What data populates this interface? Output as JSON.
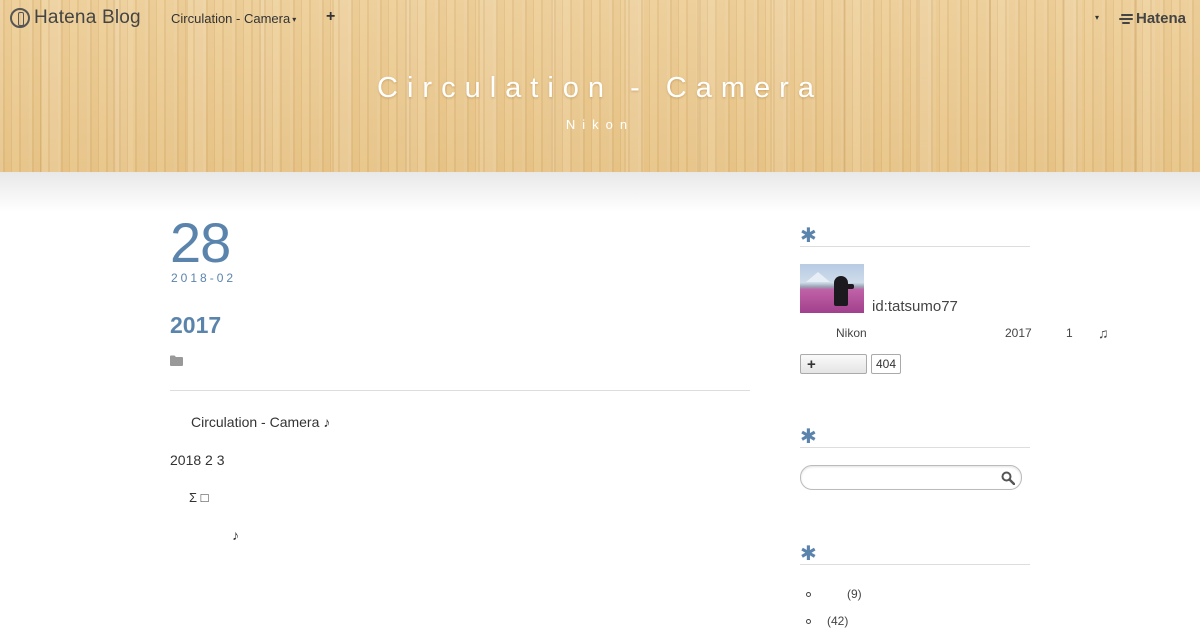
{
  "navbar": {
    "logo_text": "Hatena Blog",
    "blog_menu_label": "Circulation - Camera",
    "blog_menu_caret": "▾",
    "add_label": "+",
    "account_caret": "▾",
    "hatena_brand": "Hatena"
  },
  "header": {
    "title": "Circulation - Camera",
    "subtitle": "Nikon"
  },
  "article": {
    "date_day": "28",
    "date_ym": "2018-02",
    "title": "2017",
    "body": [
      {
        "text": "Circulation - Camera  ♪"
      },
      {
        "text": "2018 2        3"
      },
      {
        "text": "Σ    □"
      },
      {
        "text": "♪"
      }
    ]
  },
  "sidebar": {
    "profile_heading_icon": "✱",
    "user_id": "id:tatsumo77",
    "profile_text_1": "Nikon",
    "profile_text_2": "2017",
    "profile_text_3": "1",
    "profile_text_4": "♫",
    "subscribe_icon": "+",
    "subscriber_count": "404",
    "search_heading_icon": "✱",
    "search_placeholder": "",
    "category_heading_icon": "✱",
    "categories": [
      {
        "count": "(9)"
      },
      {
        "count": "(42)"
      }
    ],
    "accent_color": "#5b84ad"
  }
}
